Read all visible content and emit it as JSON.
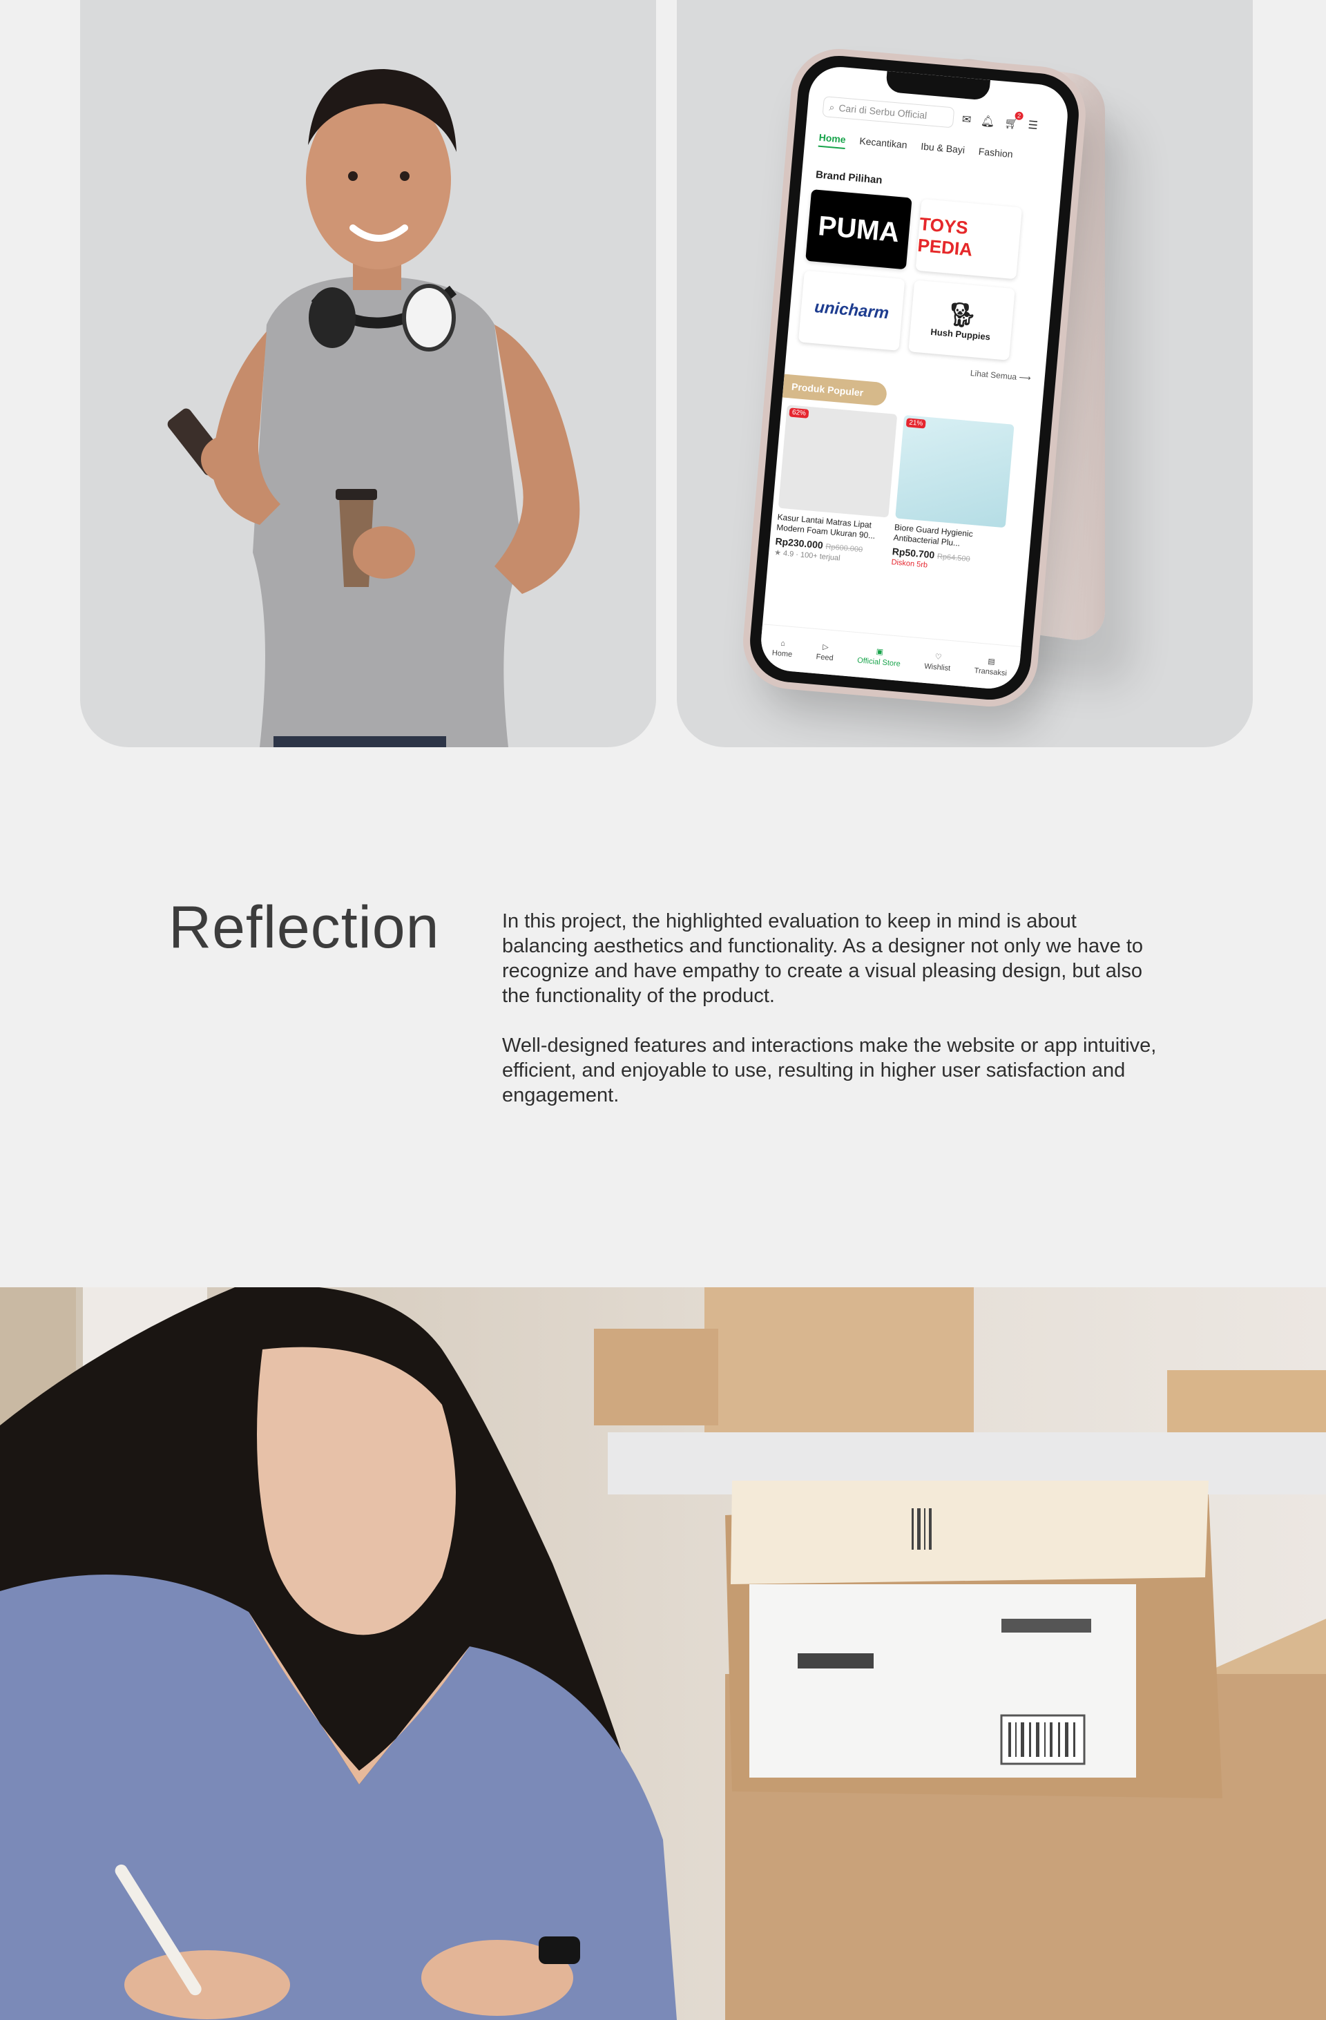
{
  "phone_app": {
    "search_placeholder": "Cari di Serbu Official",
    "cart_badge": "2",
    "tabs": [
      "Home",
      "Kecantikan",
      "Ibu & Bayi",
      "Fashion"
    ],
    "brand_section_title": "Brand Pilihan",
    "brands": [
      "PUMA",
      "TOYS PEDIA",
      "unicharm",
      "Hush Puppies"
    ],
    "see_all": "Lihat Semua ⟶",
    "popular_tag": "Produk Populer",
    "products": [
      {
        "discount": "62%",
        "name": "Kasur Lantai Matras Lipat Modern Foam Ukuran 90...",
        "price": "Rp230.000",
        "old_price": "Rp600.000",
        "meta": "★ 4.9 · 100+ terjual",
        "promo": ""
      },
      {
        "discount": "21%",
        "name": "Biore Guard Hygienic Antibacterial Plu...",
        "price": "Rp50.700",
        "old_price": "Rp64.500",
        "meta": "",
        "promo": "Diskon 5rb"
      }
    ],
    "bottom_nav": [
      "Home",
      "Feed",
      "Official Store",
      "Wishlist",
      "Transaksi"
    ]
  },
  "reflection": {
    "title": "Reflection",
    "paragraph_1": "In this project, the highlighted evaluation to keep in mind is about balancing aesthetics and functionality. As a designer not only we have to recognize and have empathy to create a visual pleasing design, but also the functionality of the product.",
    "paragraph_2": "Well-designed features and interactions make the website or app intuitive, efficient, and enjoyable to use, resulting in higher user satisfaction and engagement."
  }
}
